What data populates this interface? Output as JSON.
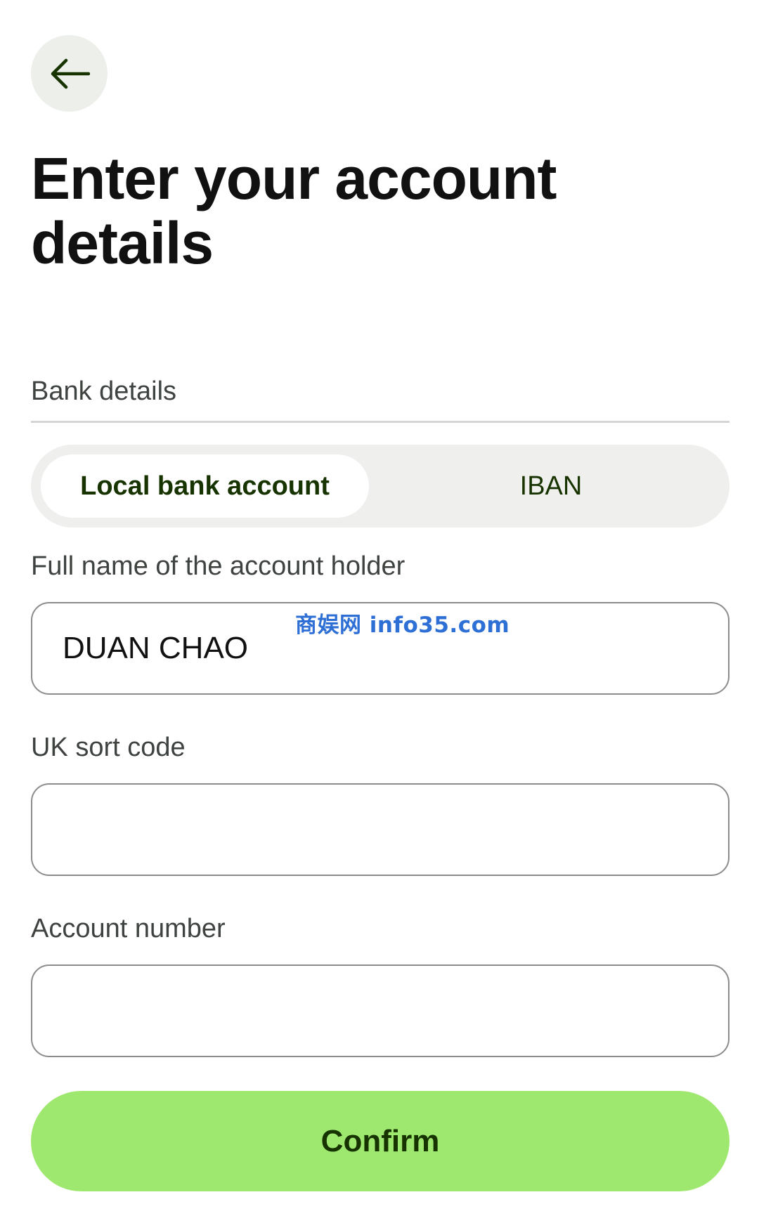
{
  "header": {
    "back_icon": "arrow-left-icon",
    "title": "Enter your account details"
  },
  "bank_details": {
    "section_label": "Bank details",
    "tabs": [
      {
        "label": "Local bank account",
        "selected": true
      },
      {
        "label": "IBAN",
        "selected": false
      }
    ]
  },
  "form": {
    "full_name": {
      "label": "Full name of the account holder",
      "value": "DUAN CHAO"
    },
    "sort_code": {
      "label": "UK sort code",
      "value": ""
    },
    "account_number": {
      "label": "Account number",
      "value": ""
    }
  },
  "watermark": "商娱网 info35.com",
  "confirm_label": "Confirm",
  "colors": {
    "accent": "#9fe870",
    "accent_text": "#163300",
    "back_bg": "#edefeb",
    "segment_bg": "#efefee",
    "watermark": "#2e6fd6"
  }
}
